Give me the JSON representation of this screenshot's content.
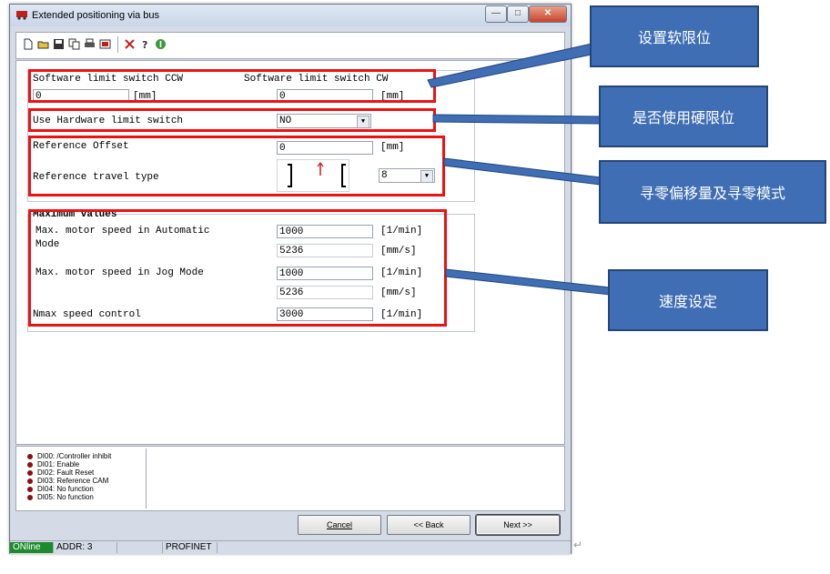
{
  "window": {
    "title": "Extended positioning via bus",
    "minimize": "—",
    "maximize": "□",
    "close": "✕"
  },
  "toolbar": {
    "icons": [
      "new-icon",
      "open-icon",
      "save-icon",
      "copy-icon",
      "print-icon",
      "export-icon",
      "tools-icon",
      "help-icon",
      "info-icon"
    ]
  },
  "limits": {
    "ccw_label": "Software limit switch CCW",
    "cw_label": "Software limit switch CW",
    "ccw_value": "0",
    "ccw_unit": "[mm]",
    "cw_value": "0",
    "cw_unit": "[mm]",
    "hw_label": "Use Hardware limit switch",
    "hw_value": "NO"
  },
  "reference": {
    "offset_label": "Reference Offset",
    "offset_value": "0",
    "offset_unit": "[mm]",
    "type_label": "Reference travel type",
    "type_value": "8"
  },
  "maximum": {
    "header": "Maximum values",
    "auto_label_1": "Max. motor speed in Automatic",
    "auto_label_2": "Mode",
    "auto_value": "1000",
    "auto_unit": "[1/min]",
    "auto_value2": "5236",
    "auto_unit2": "[mm/s]",
    "jog_label": "Max. motor speed in Jog Mode",
    "jog_value": "1000",
    "jog_unit": "[1/min]",
    "jog_value2": "5236",
    "jog_unit2": "[mm/s]",
    "nmax_label": "Nmax speed control",
    "nmax_value": "3000",
    "nmax_unit": "[1/min]"
  },
  "digital_inputs": [
    "DI00: /Controller inhibit",
    "DI01: Enable",
    "DI02: Fault Reset",
    "DI03: Reference CAM",
    "DI04: No function",
    "DI05: No function"
  ],
  "buttons": {
    "cancel": "Cancel",
    "back": "<< Back",
    "next": "Next >>"
  },
  "statusbar": {
    "online": "ONline",
    "addr": "ADDR: 3",
    "protocol": "PROFINET"
  },
  "callouts": {
    "soft_limit": "设置软限位",
    "hard_limit": "是否使用硬限位",
    "reference": "寻零偏移量及寻零模式",
    "speed": "速度设定"
  },
  "colors": {
    "callout_fill": "#3f6eb5",
    "highlight": "#ee1111",
    "online": "#1e8a2e"
  }
}
